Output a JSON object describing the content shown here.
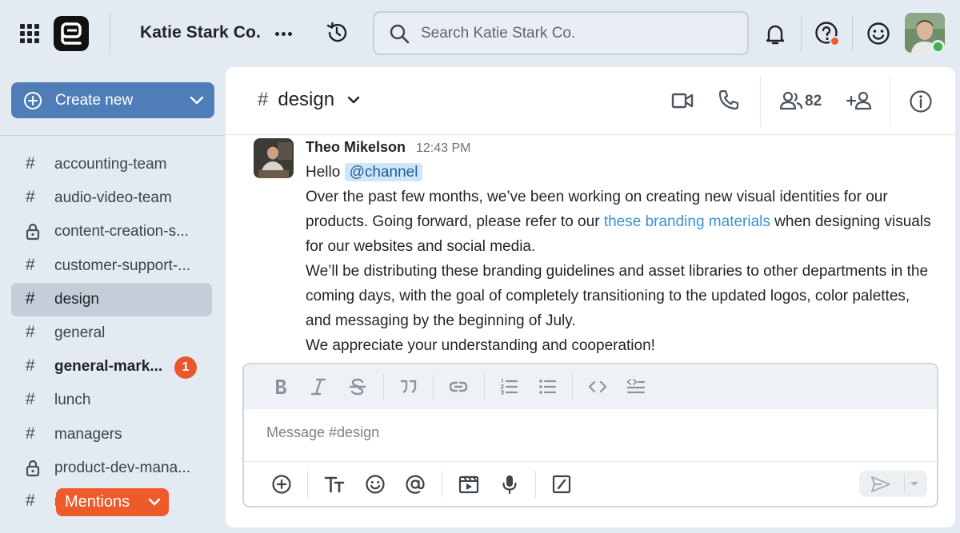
{
  "header": {
    "team_name": "Katie Stark Co.",
    "search_placeholder": "Search Katie Stark Co.",
    "icons": [
      "apps-grid-icon",
      "more-icon",
      "history-icon",
      "search-icon",
      "bell-icon",
      "help-icon",
      "emoji-icon"
    ]
  },
  "sidebar": {
    "create_new_label": "Create new",
    "channels": [
      {
        "name": "accounting-team",
        "type": "public"
      },
      {
        "name": "audio-video-team",
        "type": "public"
      },
      {
        "name": "content-creation-s...",
        "type": "private"
      },
      {
        "name": "customer-support-...",
        "type": "public"
      },
      {
        "name": "design",
        "type": "public",
        "active": true
      },
      {
        "name": "general",
        "type": "public"
      },
      {
        "name": "general-mark...",
        "type": "public",
        "unread": true,
        "badge": "1"
      },
      {
        "name": "lunch",
        "type": "public"
      },
      {
        "name": "managers",
        "type": "public"
      },
      {
        "name": "product-dev-mana...",
        "type": "private"
      },
      {
        "name": "m...",
        "type": "public"
      }
    ],
    "mentions_label": "Mentions"
  },
  "channel": {
    "hash": "#",
    "name": "design",
    "member_count": "82"
  },
  "message": {
    "author": "Theo Mikelson",
    "time": "12:43 PM",
    "greeting": "Hello",
    "mention": "@channel",
    "p1_before": "Over the past few months, we’ve been working on creating new visual identities for our products. Going forward, please refer to our ",
    "p1_link": "these branding materials",
    "p1_after": " when designing visuals for our websites and social media.",
    "p2": "We’ll be distributing these branding guidelines and asset libraries to other departments in the coming days, with the goal of completely transitioning to the updated logos, color palettes, and messaging by the beginning of July.",
    "p3": "We appreciate your understanding and cooperation!"
  },
  "composer": {
    "placeholder": "Message #design"
  },
  "colors": {
    "accent": "#4f7db8",
    "mention_bg": "#cfe6f8",
    "link": "#3b8fd8",
    "badge": "#e8582c",
    "online": "#3db34a"
  }
}
